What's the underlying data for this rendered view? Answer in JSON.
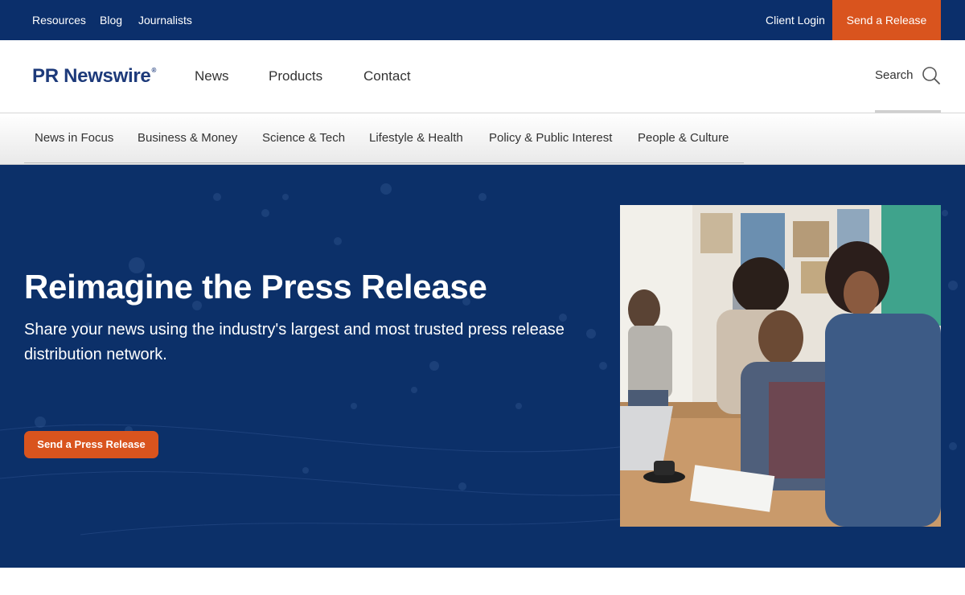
{
  "topbar": {
    "links": [
      "Resources",
      "Blog",
      "Journalists"
    ],
    "client_login": "Client Login",
    "send_release": "Send a Release"
  },
  "header": {
    "logo": "PR Newswire",
    "logo_mark": "®",
    "nav": [
      "News",
      "Products",
      "Contact"
    ],
    "search_label": "Search"
  },
  "categories": [
    "News in Focus",
    "Business & Money",
    "Science & Tech",
    "Lifestyle & Health",
    "Policy & Public Interest",
    "People & Culture"
  ],
  "hero": {
    "title": "Reimagine the Press Release",
    "subtitle": "Share your news using the industry's largest and most trusted press release distribution network.",
    "button": "Send a Press Release"
  },
  "colors": {
    "navy": "#0b2f6b",
    "accent": "#d9541e",
    "hero_bg": "#0c3069"
  }
}
